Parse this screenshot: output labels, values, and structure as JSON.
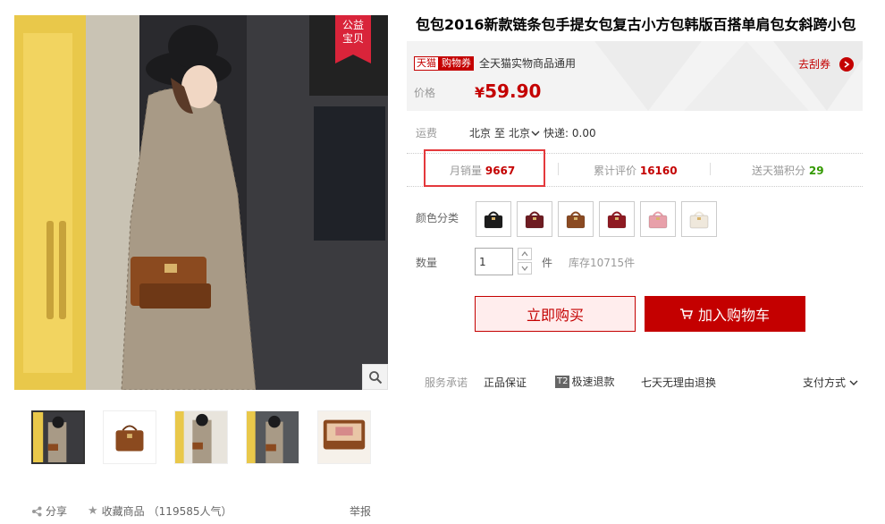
{
  "gallery": {
    "charity_badge": [
      "公益",
      "宝贝"
    ],
    "thumbnails": [
      {
        "name": "thumb-1",
        "active": true
      },
      {
        "name": "thumb-2",
        "active": false
      },
      {
        "name": "thumb-3",
        "active": false
      },
      {
        "name": "thumb-4",
        "active": false
      },
      {
        "name": "thumb-5",
        "active": false
      }
    ]
  },
  "footer": {
    "share_label": "分享",
    "favorite_label": "收藏商品",
    "favorite_count": "（119585人气）",
    "report_label": "举报"
  },
  "product": {
    "title": "包包2016新款链条包手提女包复古小方包韩版百搭单肩包女斜跨小包",
    "coupon_tag_tmall": "天猫",
    "coupon_tag": "购物券",
    "coupon_text": "全天猫实物商品通用",
    "grab_coupon": "去刮券",
    "price_label": "价格",
    "currency": "¥",
    "price": "59.90",
    "shipping_label": "运费",
    "ship_from": "北京",
    "ship_to_word": "至",
    "ship_to": "北京",
    "ship_method": "快递: 0.00",
    "monthly_sales_label": "月销量",
    "monthly_sales": "9667",
    "reviews_label": "累计评价",
    "reviews": "16160",
    "points_label": "送天猫积分",
    "points": "29",
    "color_label": "颜色分类",
    "swatches": [
      {
        "name": "black",
        "color": "#1c1c1c"
      },
      {
        "name": "wine",
        "color": "#6e1c22"
      },
      {
        "name": "brown",
        "color": "#8a4a22"
      },
      {
        "name": "red",
        "color": "#8e1a22"
      },
      {
        "name": "pink",
        "color": "#e8a0aa"
      },
      {
        "name": "beige",
        "color": "#efe8dc"
      }
    ],
    "qty_label": "数量",
    "qty_value": "1",
    "unit": "件",
    "stock": "库存10715件",
    "buy_now": "立即购买",
    "add_to_cart": "加入购物车",
    "service_label": "服务承诺",
    "service_1": "正品保证",
    "service_2_badge": "T2",
    "service_2": "极速退款",
    "service_3": "七天无理由退换",
    "payment": "支付方式"
  },
  "colors": {
    "accent": "#c40000",
    "highlight": "#e4393c",
    "points_green": "#339900"
  }
}
